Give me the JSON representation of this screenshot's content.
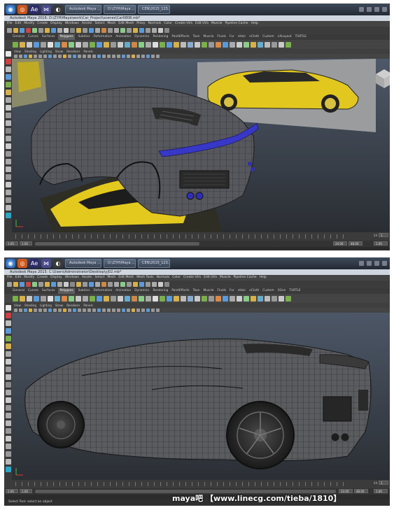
{
  "taskbar": {
    "tasks": [
      {
        "label": "Autodesk Maya ..."
      },
      {
        "label": "D:\\ZYH\\Maya ..."
      },
      {
        "label": "CEN\\2015_123..."
      }
    ]
  },
  "shots": [
    {
      "title": "Autodesk Maya 2016: D:\\ZYH\\Maya\\work\\Car_Project\\scenes\\Car0808.mb*",
      "menus": [
        "File",
        "Edit",
        "Modify",
        "Create",
        "Display",
        "Windows",
        "Assets",
        "Select",
        "Mesh",
        "Edit Mesh",
        "Proxy",
        "Normals",
        "Color",
        "Create UVs",
        "Edit UVs",
        "Muscle",
        "Pipeline Cache",
        "Help"
      ],
      "shelf_tabs": [
        "General",
        "Curves",
        "Surfaces",
        "Polygons",
        "Subdivs",
        "Deformation",
        "Animation",
        "Dynamics",
        "Rendering",
        "PaintEffects",
        "Toon",
        "Muscle",
        "Fluids",
        "Fur",
        "nHair",
        "nCloth",
        "Custom",
        "LXLayout",
        "TURTLE"
      ],
      "active_shelf": "Polygons",
      "panel_menu": [
        "View",
        "Shading",
        "Lighting",
        "Show",
        "Renderer",
        "Panels"
      ],
      "time": {
        "start": "1.00",
        "current": "1.00",
        "frame": "1",
        "end": "24.00",
        "range_end": "48.00",
        "end_marker": "24",
        "current_frame_field": "1.00"
      }
    },
    {
      "title": "Autodesk Maya 2015: C:\\Users\\Administrator\\Desktop\\yj02.mb*",
      "menus": [
        "File",
        "Edit",
        "Modify",
        "Create",
        "Display",
        "Windows",
        "Assets",
        "Select",
        "Mesh",
        "Edit Mesh",
        "Mesh Tools",
        "Normals",
        "Color",
        "Create UVs",
        "Edit UVs",
        "Muscle",
        "Pipeline Cache",
        "Help"
      ],
      "shelf_tabs": [
        "General",
        "Curves",
        "Surfaces",
        "Polygons",
        "Subdivs",
        "Deformation",
        "Animation",
        "Dynamics",
        "Rendering",
        "PaintEffects",
        "Toon",
        "Muscle",
        "Fluids",
        "Fur",
        "nHair",
        "nCloth",
        "Custom",
        "XGen",
        "TURTLE"
      ],
      "active_shelf": "Polygons",
      "panel_menu": [
        "View",
        "Shading",
        "Lighting",
        "Show",
        "Renderer",
        "Panels"
      ],
      "time": {
        "start": "1.00",
        "current": "1.00",
        "frame": "1",
        "end": "24.00",
        "range_end": "48.00",
        "end_marker": "24",
        "current_frame_field": "1.00"
      },
      "help_line": "Select Tool: select an object"
    }
  ],
  "watermark": "maya吧 【www.linecg.com/tieba/1810】",
  "colors": {
    "viewport_top": "#4a5564",
    "viewport_bottom": "#2b2f34",
    "car_yellow": "#e0c81e",
    "mesh_gray": "#5a5a5e",
    "selection_blue": "#3a3ad0",
    "maya_teal": "#2aa8c8"
  }
}
